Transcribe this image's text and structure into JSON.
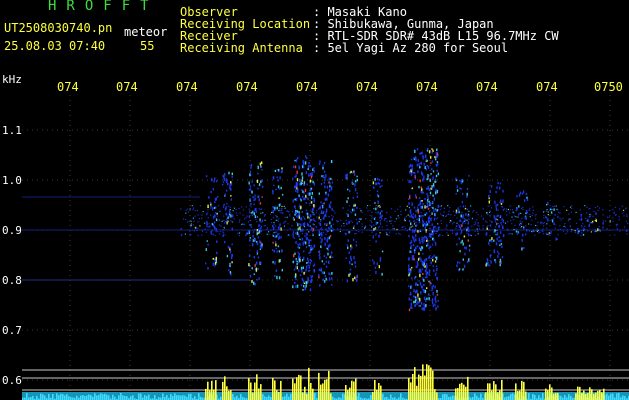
{
  "header": {
    "app_title": "HROFFT",
    "filename": "UT2508030740.pn",
    "event_tag": "meteor",
    "datetime": "25.08.03 07:40",
    "count": "55",
    "info": [
      {
        "label": "Observer",
        "value": ": Masaki Kano"
      },
      {
        "label": "Receiving Location",
        "value": ": Shibukawa, Gunma, Japan"
      },
      {
        "label": "Receiver",
        "value": ": RTL-SDR SDR# 43dB L15 96.7MHz CW"
      },
      {
        "label": "Receiving Antenna",
        "value": ": 5el Yagi Az 280 for Seoul"
      }
    ]
  },
  "axis": {
    "unit": "kHz",
    "x_ticks": [
      "074",
      "074",
      "074",
      "074",
      "074",
      "074",
      "074",
      "074",
      "074",
      "0750"
    ],
    "y_ticks": [
      "1.1",
      "1.0",
      "0.9",
      "0.8",
      "0.7",
      "0.6"
    ]
  },
  "colors": {
    "background": "#000000",
    "title": "#3fdc3f",
    "label": "#ffff3f",
    "value": "#ffffff",
    "signal_low": "#1e3cff",
    "signal_mid": "#3fdcff",
    "signal_high": "#ffff3f",
    "signal_peak": "#ff3f3f"
  }
}
